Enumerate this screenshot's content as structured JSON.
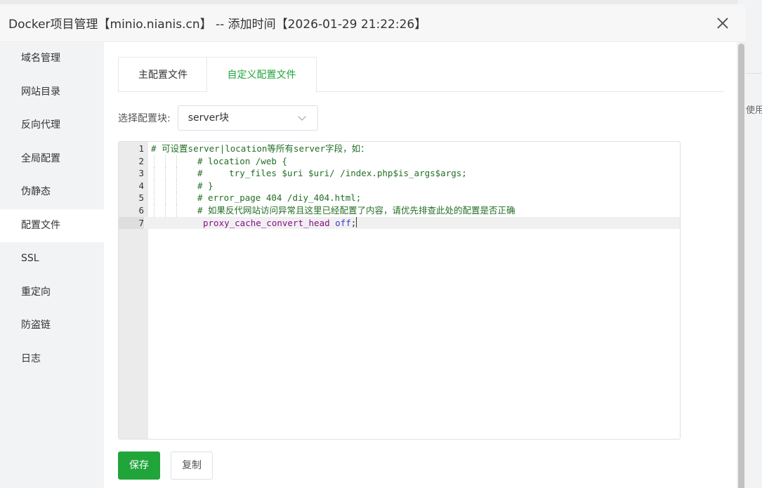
{
  "background": {
    "partial_text": "使用帮"
  },
  "modal": {
    "title": "Docker项目管理【minio.nianis.cn】 -- 添加时间【2026-01-29 21:22:26】"
  },
  "sidebar": {
    "items": [
      {
        "label": "域名管理"
      },
      {
        "label": "网站目录"
      },
      {
        "label": "反向代理"
      },
      {
        "label": "全局配置"
      },
      {
        "label": "伪静态"
      },
      {
        "label": "配置文件",
        "active": true
      },
      {
        "label": "SSL"
      },
      {
        "label": "重定向"
      },
      {
        "label": "防盗链"
      },
      {
        "label": "日志"
      }
    ]
  },
  "tabs": [
    {
      "label": "主配置文件"
    },
    {
      "label": "自定义配置文件",
      "active": true
    }
  ],
  "config_block": {
    "label": "选择配置块:",
    "selected": "server块"
  },
  "editor": {
    "active_line": 7,
    "lines": [
      {
        "num": "1",
        "text": "# 可设置server|location等所有server字段，如："
      },
      {
        "num": "2",
        "text": "# location /web {"
      },
      {
        "num": "3",
        "text": "#     try_files $uri $uri/ /index.php$is_args$args;"
      },
      {
        "num": "4",
        "text": "# }"
      },
      {
        "num": "5",
        "text": "# error_page 404 /diy_404.html;"
      },
      {
        "num": "6",
        "text": "# 如果反代网站访问异常且这里已经配置了内容，请优先排查此处的配置是否正确"
      },
      {
        "num": "7",
        "directive": "proxy_cache_convert_head",
        "value": "off",
        "punct": ";"
      }
    ]
  },
  "buttons": {
    "save": "保存",
    "copy": "复制"
  },
  "colors": {
    "accent": "#20a53a"
  }
}
